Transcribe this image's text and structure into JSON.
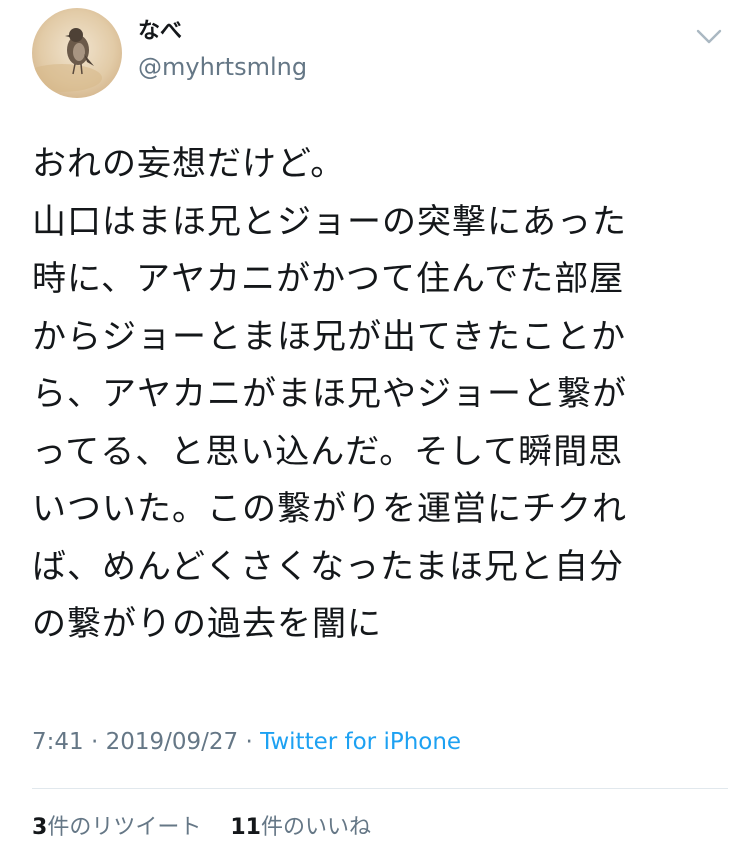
{
  "user": {
    "display_name": "なべ",
    "handle": "@myhrtsmlng",
    "avatar_icon": "sparrow-photo-avatar"
  },
  "menu": {
    "icon": "chevron-down-icon"
  },
  "tweet": {
    "lines": [
      "おれの妄想だけど。",
      "山口はまほ兄とジョーの突撃にあった",
      "時に、アヤカニがかつて住んでた部屋",
      "からジョーとまほ兄が出てきたことか",
      "ら、アヤカニがまほ兄やジョーと繋が",
      "ってる、と思い込んだ。そして瞬間思",
      "いついた。この繋がりを運営にチクれ",
      "ば、めんどくさくなったまほ兄と自分",
      "の繋がりの過去を闇に"
    ]
  },
  "meta": {
    "time": "7:41",
    "separator": " · ",
    "date": "2019/09/27",
    "source": "Twitter for iPhone"
  },
  "stats": {
    "retweets_count": "3",
    "retweets_label": "件のリツイート",
    "likes_count": "11",
    "likes_label": "件のいいね"
  },
  "colors": {
    "text": "#14171a",
    "secondary": "#657786",
    "link": "#1da1f2",
    "divider": "#e1e8ed"
  }
}
